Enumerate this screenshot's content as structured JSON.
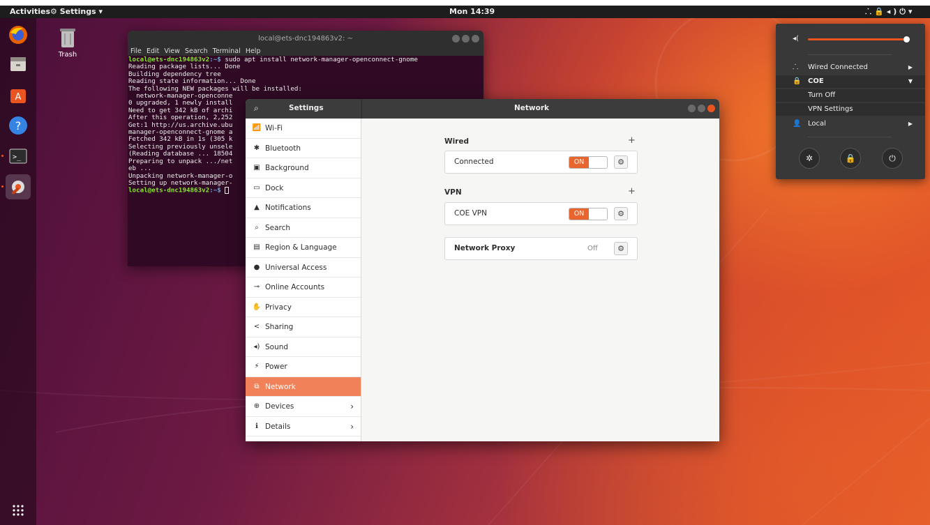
{
  "topbar": {
    "activities": "Activities",
    "app_menu": "Settings ▾",
    "clock": "Mon 14:39",
    "tray_icons": [
      "network-icon",
      "vpn-icon",
      "volume-icon",
      "power-icon"
    ]
  },
  "desktop": {
    "trash_label": "Trash"
  },
  "dock": {
    "apps": [
      "firefox-icon",
      "files-icon",
      "software-icon",
      "help-icon",
      "terminal-icon",
      "settings-icon"
    ],
    "show_apps_icon": "grid-icon"
  },
  "terminal": {
    "title": "local@ets-dnc194863v2: ~",
    "menu": [
      "File",
      "Edit",
      "View",
      "Search",
      "Terminal",
      "Help"
    ],
    "prompt_user": "local@ets-dnc194863v2",
    "prompt_path": ":~$",
    "command": " sudo apt install network-manager-openconnect-gnome",
    "lines": [
      "Reading package lists... Done",
      "Building dependency tree",
      "Reading state information... Done",
      "The following NEW packages will be installed:",
      "  network-manager-openconne",
      "0 upgraded, 1 newly install",
      "Need to get 342 kB of archi",
      "After this operation, 2,252",
      "Get:1 http://us.archive.ubu",
      "manager-openconnect-gnome a",
      "Fetched 342 kB in 1s (305 k",
      "Selecting previously unsele",
      "(Reading database ... 18504",
      "Preparing to unpack .../net",
      "eb ...",
      "Unpacking network-manager-o",
      "Setting up network-manager-"
    ],
    "final_prompt_user": "local@ets-dnc194863v2",
    "final_prompt_path": ":~$"
  },
  "settings": {
    "sidebar_title": "Settings",
    "panel_title": "Network",
    "sidebar_items": [
      {
        "label": "Wi-Fi",
        "icon": "wifi-icon",
        "glyph": "📶"
      },
      {
        "label": "Bluetooth",
        "icon": "bluetooth-icon",
        "glyph": "✱"
      },
      {
        "label": "Background",
        "icon": "background-icon",
        "glyph": "▣"
      },
      {
        "label": "Dock",
        "icon": "dock-icon",
        "glyph": "▭"
      },
      {
        "label": "Notifications",
        "icon": "notifications-icon",
        "glyph": "▲"
      },
      {
        "label": "Search",
        "icon": "search-icon",
        "glyph": "⌕"
      },
      {
        "label": "Region & Language",
        "icon": "region-icon",
        "glyph": "▤"
      },
      {
        "label": "Universal Access",
        "icon": "universal-access-icon",
        "glyph": "●"
      },
      {
        "label": "Online Accounts",
        "icon": "online-accounts-icon",
        "glyph": "⊸"
      },
      {
        "label": "Privacy",
        "icon": "privacy-icon",
        "glyph": "✋"
      },
      {
        "label": "Sharing",
        "icon": "sharing-icon",
        "glyph": "<"
      },
      {
        "label": "Sound",
        "icon": "sound-icon",
        "glyph": "◂)"
      },
      {
        "label": "Power",
        "icon": "power-icon",
        "glyph": "⚡"
      },
      {
        "label": "Network",
        "icon": "network-icon",
        "glyph": "⧉"
      },
      {
        "label": "Devices",
        "icon": "devices-icon",
        "glyph": "⊕"
      },
      {
        "label": "Details",
        "icon": "details-icon",
        "glyph": "ℹ"
      }
    ],
    "network": {
      "wired_title": "Wired",
      "wired_status": "Connected",
      "wired_toggle": "ON",
      "vpn_title": "VPN",
      "vpn_name": "COE VPN",
      "vpn_toggle": "ON",
      "proxy_label": "Network Proxy",
      "proxy_status": "Off",
      "add_symbol": "+"
    }
  },
  "system_menu": {
    "volume_level": 1.0,
    "wired": "Wired Connected",
    "vpn": "COE",
    "vpn_turn_off": "Turn Off",
    "vpn_settings": "VPN Settings",
    "user": "Local",
    "buttons": [
      "settings-icon",
      "lock-icon",
      "power-icon"
    ]
  },
  "colors": {
    "accent": "#e95420",
    "selected": "#f08159",
    "toggle_on": "#e8652f"
  }
}
